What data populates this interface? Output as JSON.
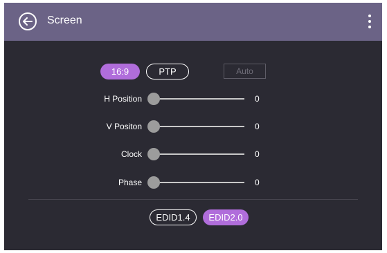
{
  "header": {
    "title": "Screen"
  },
  "aspect": {
    "options": [
      "16:9",
      "PTP"
    ],
    "selected": "16:9",
    "auto_label": "Auto"
  },
  "adjustments": [
    {
      "label": "H Position",
      "value": "0",
      "level": 0
    },
    {
      "label": "V Positon",
      "value": "0",
      "level": 0
    },
    {
      "label": "Clock",
      "value": "0",
      "level": 0
    },
    {
      "label": "Phase",
      "value": "0",
      "level": 0
    }
  ],
  "edid": {
    "options": [
      "EDID1.4",
      "EDID2.0"
    ],
    "selected": "EDID2.0"
  },
  "colors": {
    "header": "#6b6386",
    "background": "#2b2a33",
    "accent": "#b06ddb"
  },
  "icons": {
    "back": "back-arrow-icon",
    "menu": "more-vertical-icon"
  }
}
